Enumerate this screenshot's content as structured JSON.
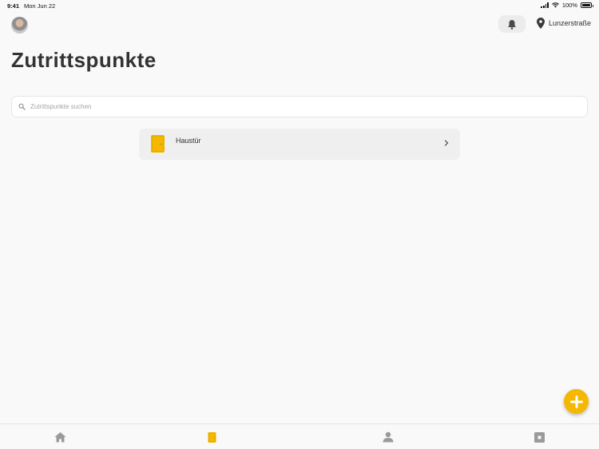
{
  "status_bar": {
    "time": "9:41",
    "date": "Mon Jun 22",
    "battery": "100%"
  },
  "header": {
    "location": "Lunzerstraße",
    "avatar_icon": "user-avatar",
    "bell_icon": "bell-icon",
    "location_icon": "map-pin-icon"
  },
  "page": {
    "title": "Zutrittspunkte"
  },
  "search": {
    "placeholder": "Zutrittspunkte suchen",
    "value": ""
  },
  "access_points": [
    {
      "label": "Haustür",
      "icon": "door-icon"
    }
  ],
  "fab": {
    "icon": "plus-icon"
  },
  "tabs": [
    {
      "name": "home",
      "icon": "home-icon",
      "active": false
    },
    {
      "name": "access-points",
      "icon": "door-icon",
      "active": true
    },
    {
      "name": "profile",
      "icon": "person-icon",
      "active": false
    },
    {
      "name": "more",
      "icon": "square-icon",
      "active": false
    }
  ],
  "colors": {
    "accent": "#f5b800",
    "background": "#f9f9f9",
    "tab_inactive": "#9a9a9a"
  }
}
